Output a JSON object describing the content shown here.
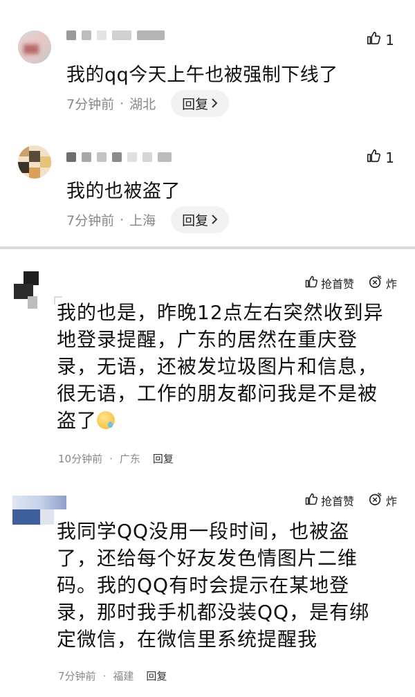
{
  "comments_top": [
    {
      "like_count": "1",
      "text": "我的qq今天上午也被强制下线了",
      "time": "7分钟前",
      "location": "湖北",
      "reply_label": "回复"
    },
    {
      "like_count": "1",
      "text": "我的也被盗了",
      "time": "7分钟前",
      "location": "上海",
      "reply_label": "回复"
    }
  ],
  "comments_bottom": [
    {
      "grab_label": "抢首赞",
      "bomb_label": "炸",
      "lines": [
        "我的也是，昨晚12点左右突然收到异",
        "地登录提醒，广东的居然在重庆登",
        "录，无语，还被发垃圾图片和信息，",
        "很无语，工作的朋友都问我是不是被",
        "盗了"
      ],
      "time": "10分钟前",
      "location": "广东",
      "reply_label": "回复"
    },
    {
      "grab_label": "抢首赞",
      "bomb_label": "炸",
      "lines": [
        "我同学QQ没用一段时间，也被盗",
        "了，还给每个好友发色情图片二维",
        "码。我的QQ有时会提示在某地登",
        "录，那时我手机都没装QQ，是有绑",
        "定微信，在微信里系统提醒我"
      ],
      "time": "7分钟前",
      "location": "福建",
      "reply_label": "回复"
    }
  ],
  "separator": "·",
  "icons": {
    "like": "thumbs-up-icon",
    "reply_arrow": "chevron-right-icon",
    "bomb": "bomb-icon",
    "emoji": "sweat-face-emoji"
  }
}
